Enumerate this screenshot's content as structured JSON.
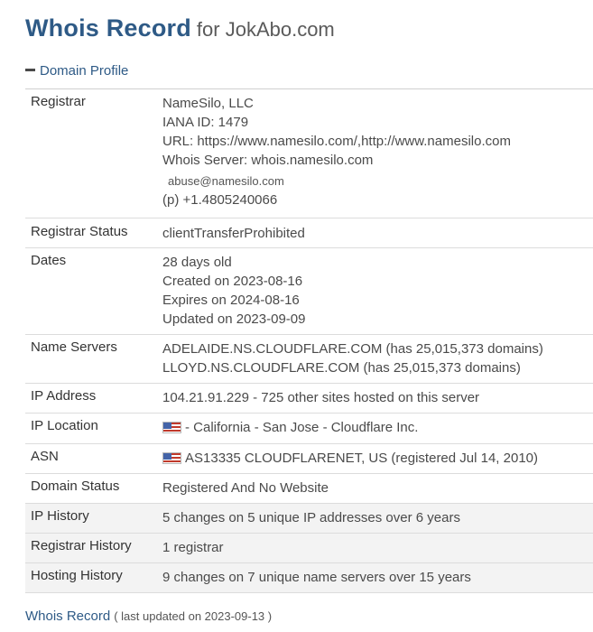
{
  "header": {
    "title": "Whois Record",
    "subtitle": "for JokAbo.com"
  },
  "section": {
    "toggle_label": "Domain Profile"
  },
  "registrar": {
    "label": "Registrar",
    "name": "NameSilo, LLC",
    "iana": "IANA ID: 1479",
    "url": "URL: https://www.namesilo.com/,http://www.namesilo.com",
    "whois_server": "Whois Server: whois.namesilo.com",
    "email": "abuse@namesilo.com",
    "phone": "(p) +1.4805240066"
  },
  "registrar_status": {
    "label": "Registrar Status",
    "value": "clientTransferProhibited"
  },
  "dates": {
    "label": "Dates",
    "age": "28 days old",
    "created": "Created on 2023-08-16",
    "expires": "Expires on 2024-08-16",
    "updated": "Updated on 2023-09-09"
  },
  "name_servers": {
    "label": "Name Servers",
    "items": [
      "ADELAIDE.NS.CLOUDFLARE.COM (has 25,015,373 domains)",
      "LLOYD.NS.CLOUDFLARE.COM (has 25,015,373 domains)"
    ]
  },
  "ip_address": {
    "label": "IP Address",
    "value": "104.21.91.229 - 725 other sites hosted on this server"
  },
  "ip_location": {
    "label": "IP Location",
    "value": "- California - San Jose - Cloudflare Inc."
  },
  "asn": {
    "label": "ASN",
    "value": "AS13335 CLOUDFLARENET, US (registered Jul 14, 2010)"
  },
  "domain_status": {
    "label": "Domain Status",
    "value": "Registered And No Website"
  },
  "ip_history": {
    "label": "IP History",
    "value": "5 changes on 5 unique IP addresses over 6 years"
  },
  "registrar_history": {
    "label": "Registrar History",
    "value": "1 registrar"
  },
  "hosting_history": {
    "label": "Hosting History",
    "value": "9 changes on 7 unique name servers over 15 years"
  },
  "footer": {
    "title": "Whois Record",
    "note": "( last updated on 2023-09-13 )"
  },
  "colors": {
    "accent": "#2e5a86",
    "text": "#4a4a4a",
    "shaded_row": "#f3f3f3",
    "border": "#dcdcdc"
  },
  "icons": {
    "section_toggle": "minus-icon",
    "country_flag": "us-flag-icon"
  }
}
